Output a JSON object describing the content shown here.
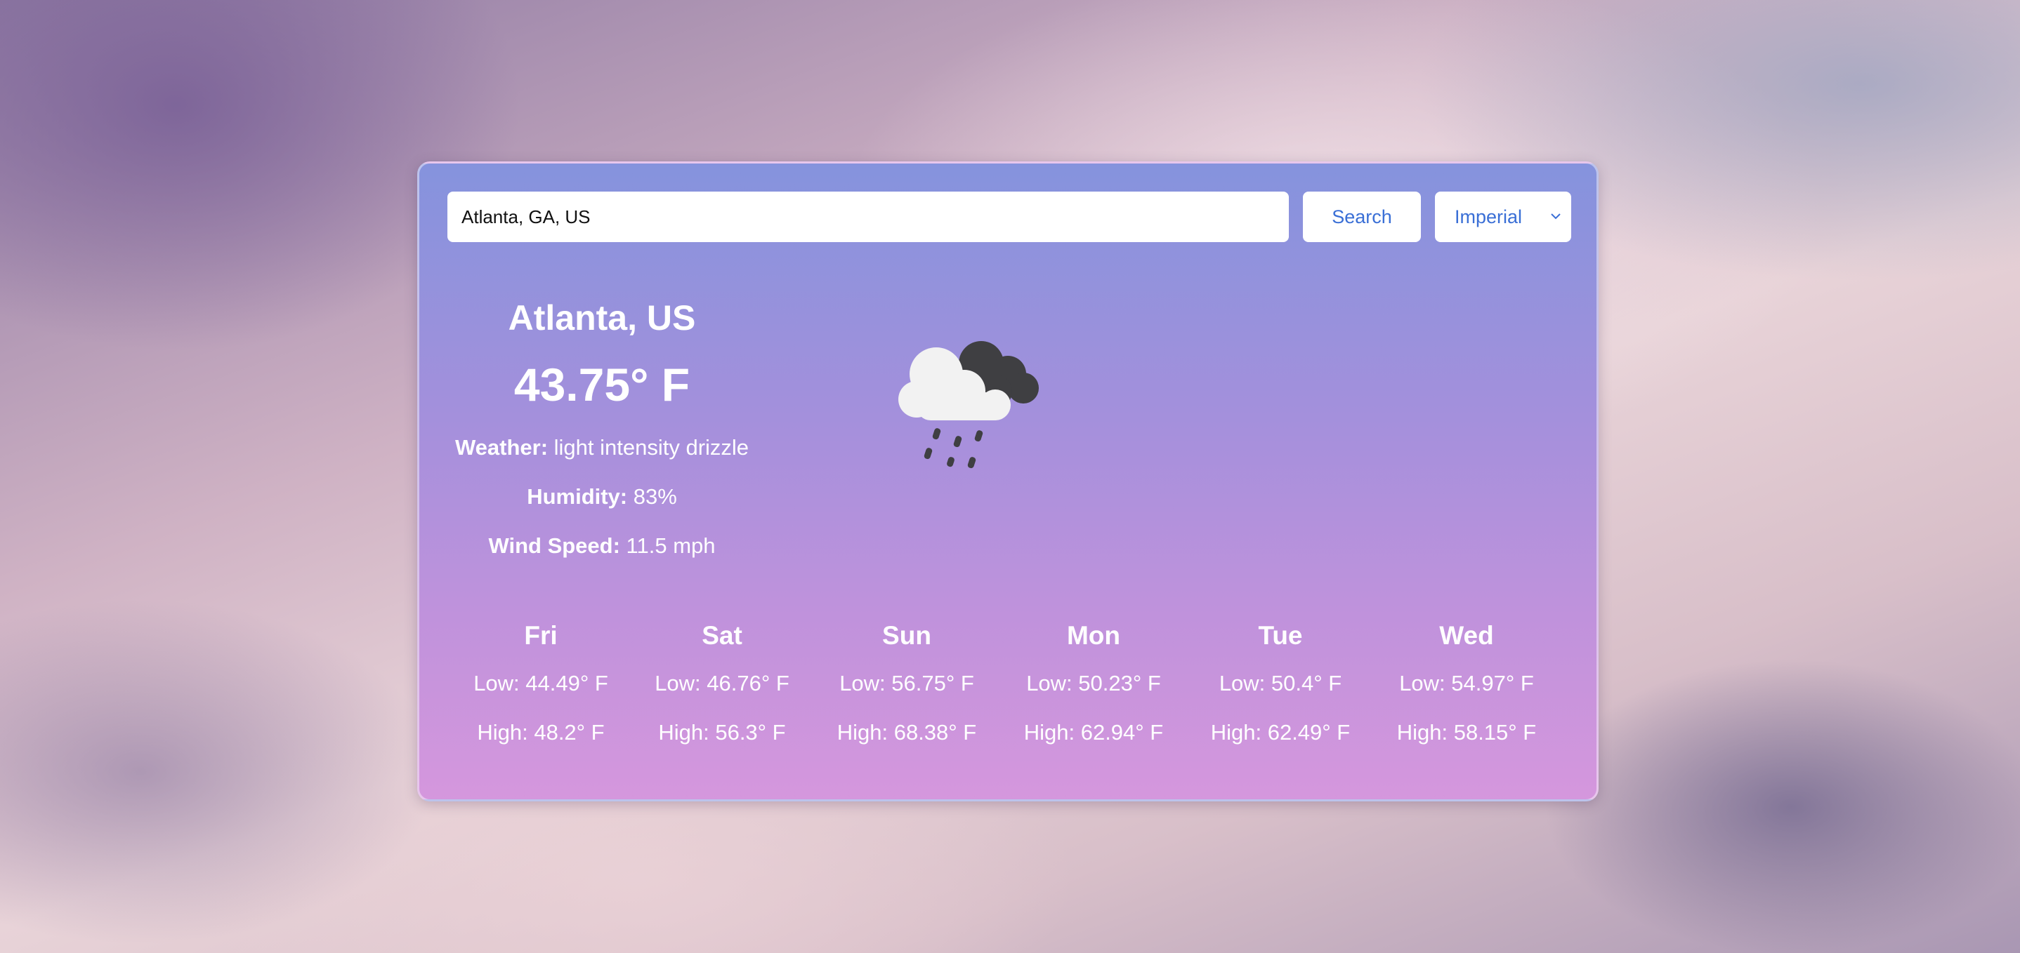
{
  "search": {
    "value": "Atlanta, GA, US",
    "button_label": "Search",
    "units_selected": "Imperial"
  },
  "current": {
    "city": "Atlanta, US",
    "temperature": "43.75° F",
    "weather_label": "Weather:",
    "weather_value": " light intensity drizzle",
    "humidity_label": "Humidity:",
    "humidity_value": " 83%",
    "wind_label": "Wind Speed:",
    "wind_value": " 11.5 mph",
    "icon": "cloud-drizzle-icon"
  },
  "forecast": [
    {
      "day": "Fri",
      "low": "Low: 44.49° F",
      "high": "High: 48.2° F"
    },
    {
      "day": "Sat",
      "low": "Low: 46.76° F",
      "high": "High: 56.3° F"
    },
    {
      "day": "Sun",
      "low": "Low: 56.75° F",
      "high": "High: 68.38° F"
    },
    {
      "day": "Mon",
      "low": "Low: 50.23° F",
      "high": "High: 62.94° F"
    },
    {
      "day": "Tue",
      "low": "Low: 50.4° F",
      "high": "High: 62.49° F"
    },
    {
      "day": "Wed",
      "low": "Low: 54.97° F",
      "high": "High: 58.15° F"
    }
  ],
  "colors": {
    "accent": "#3a6fd6",
    "card_top": "#8593dd",
    "card_bottom": "#d597dd"
  }
}
